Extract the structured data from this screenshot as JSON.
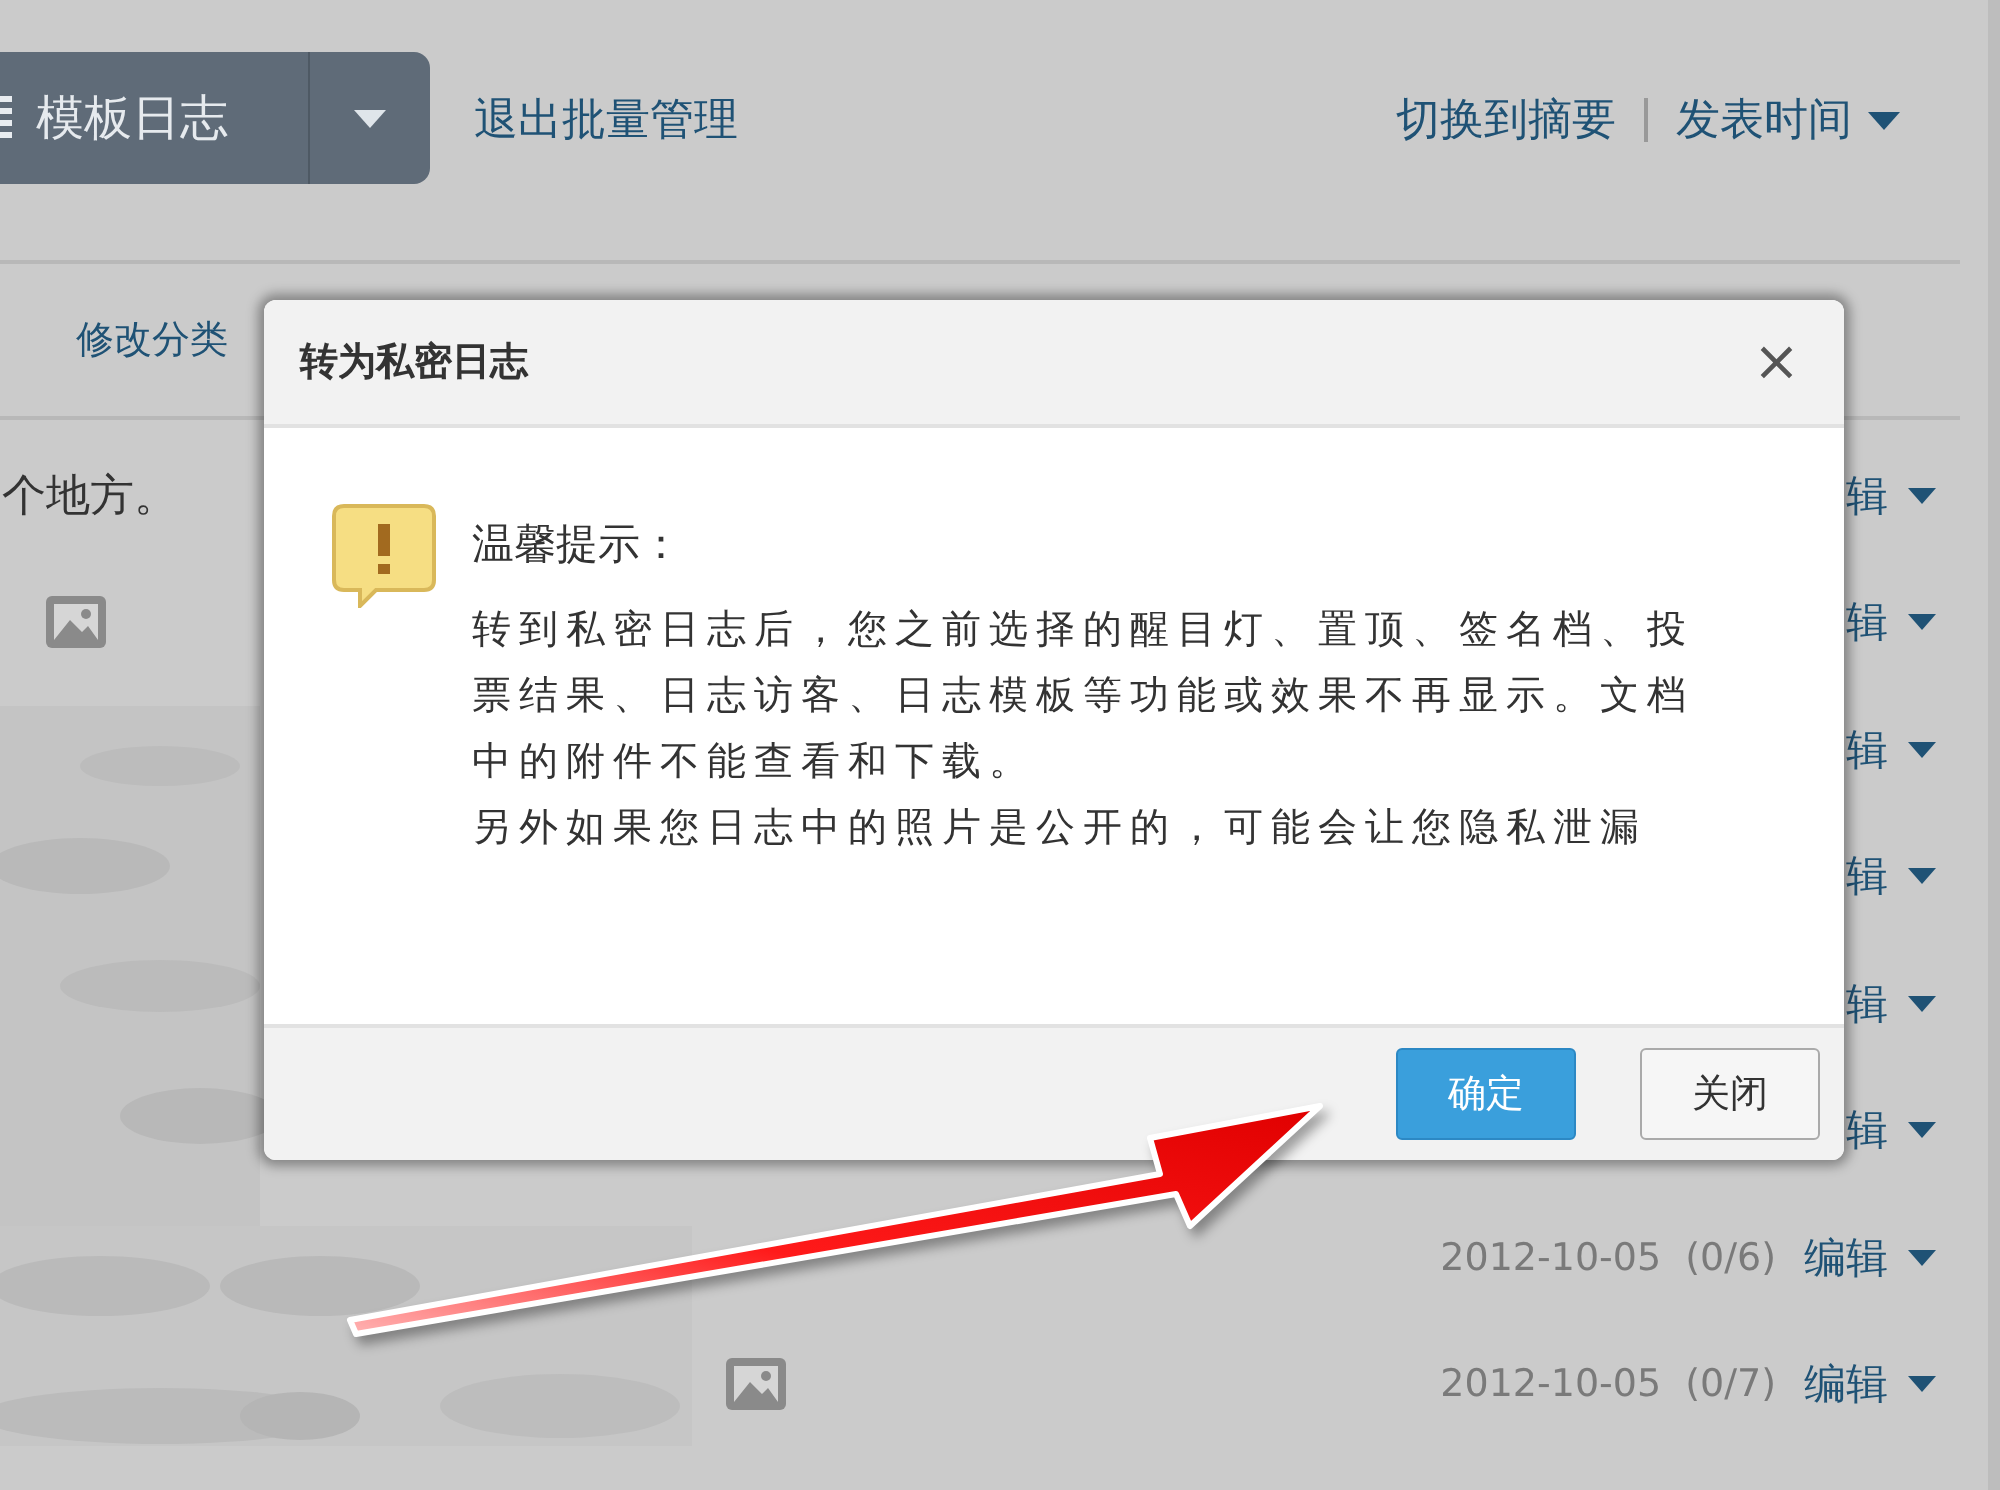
{
  "toolbar": {
    "template_button": "模板日志",
    "exit_link": "退出批量管理",
    "summary_link": "切换到摘要",
    "sort_link": "发表时间"
  },
  "actions": {
    "edit_category": "修改分类"
  },
  "rows": [
    {
      "text": "个地方。",
      "has_image": false,
      "date": "",
      "count": "",
      "edit": "辑"
    },
    {
      "text": "",
      "has_image": true,
      "date": "",
      "count": "",
      "edit": "辑"
    },
    {
      "text": "",
      "has_image": false,
      "date": "",
      "count": "",
      "edit": "辑"
    },
    {
      "text": "",
      "has_image": false,
      "date": "",
      "count": "",
      "edit": "辑"
    },
    {
      "text": "",
      "has_image": false,
      "date": "",
      "count": "",
      "edit": "辑"
    },
    {
      "text": "",
      "has_image": false,
      "date": "",
      "count": "",
      "edit": "辑"
    },
    {
      "text": "",
      "has_image": false,
      "date": "2012-10-05",
      "count": "(0/6)",
      "edit": "编辑"
    },
    {
      "text": "",
      "has_image": true,
      "date": "2012-10-05",
      "count": "(0/7)",
      "edit": "编辑"
    }
  ],
  "dialog": {
    "title": "转为私密日志",
    "close": "×",
    "heading": "温馨提示：",
    "paragraphs": [
      "转到私密日志后，您之前选择的醒目灯、置顶、签名档、投票结果、日志访客、日志模板等功能或效果不再显示。文档中的附件不能查看和下载。",
      "另外如果您日志中的照片是公开的，可能会让您隐私泄漏"
    ],
    "buttons": [
      {
        "label": "确定",
        "kind": "primary"
      },
      {
        "label": "关闭",
        "kind": "secondary"
      }
    ]
  }
}
